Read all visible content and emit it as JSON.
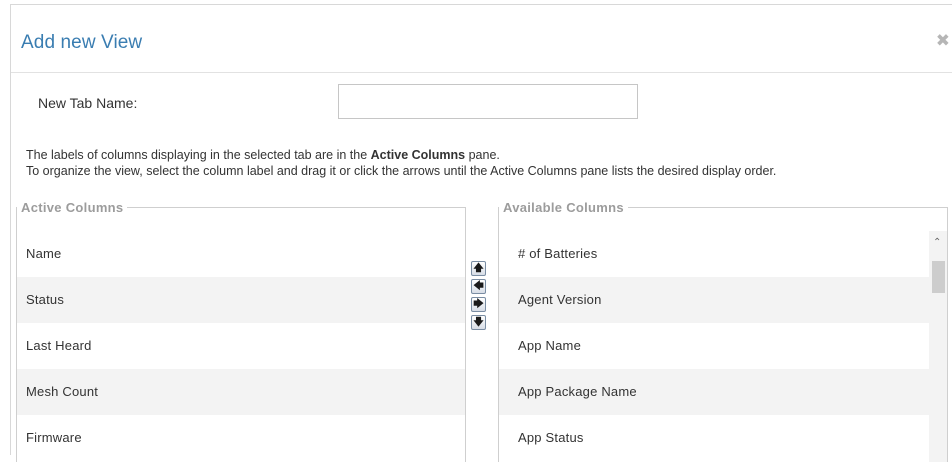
{
  "dialog": {
    "title": "Add new View",
    "close_icon": "close-icon",
    "close_glyph": "✖"
  },
  "form": {
    "tab_name_label": "New Tab Name:",
    "tab_name_value": "",
    "tab_name_placeholder": ""
  },
  "description": {
    "line1_prefix": "The labels of columns displaying in the selected tab are in the ",
    "line1_bold": "Active Columns",
    "line1_suffix": " pane.",
    "line2": "To organize the view, select the column label and drag it or click the arrows until the Active Columns pane lists the desired display order."
  },
  "active_columns": {
    "legend": "Active Columns",
    "items": [
      "Name",
      "Status",
      "Last Heard",
      "Mesh Count",
      "Firmware"
    ]
  },
  "available_columns": {
    "legend": "Available Columns",
    "items": [
      "# of Batteries",
      "Agent Version",
      "App Name",
      "App Package Name",
      "App Status"
    ]
  },
  "arrows": {
    "up": {
      "icon": "arrow-up-icon",
      "glyph": "🡅"
    },
    "left": {
      "icon": "arrow-left-icon",
      "glyph": "🡄"
    },
    "right": {
      "icon": "arrow-right-icon",
      "glyph": "🡆"
    },
    "down": {
      "icon": "arrow-down-icon",
      "glyph": "🡇"
    }
  },
  "scrollbar": {
    "up_icon": "scroll-up-icon",
    "up_glyph": "⌃"
  },
  "colors": {
    "title": "#3a7db1",
    "legend": "#9c9c9c",
    "row_alt": "#f3f3f3"
  }
}
